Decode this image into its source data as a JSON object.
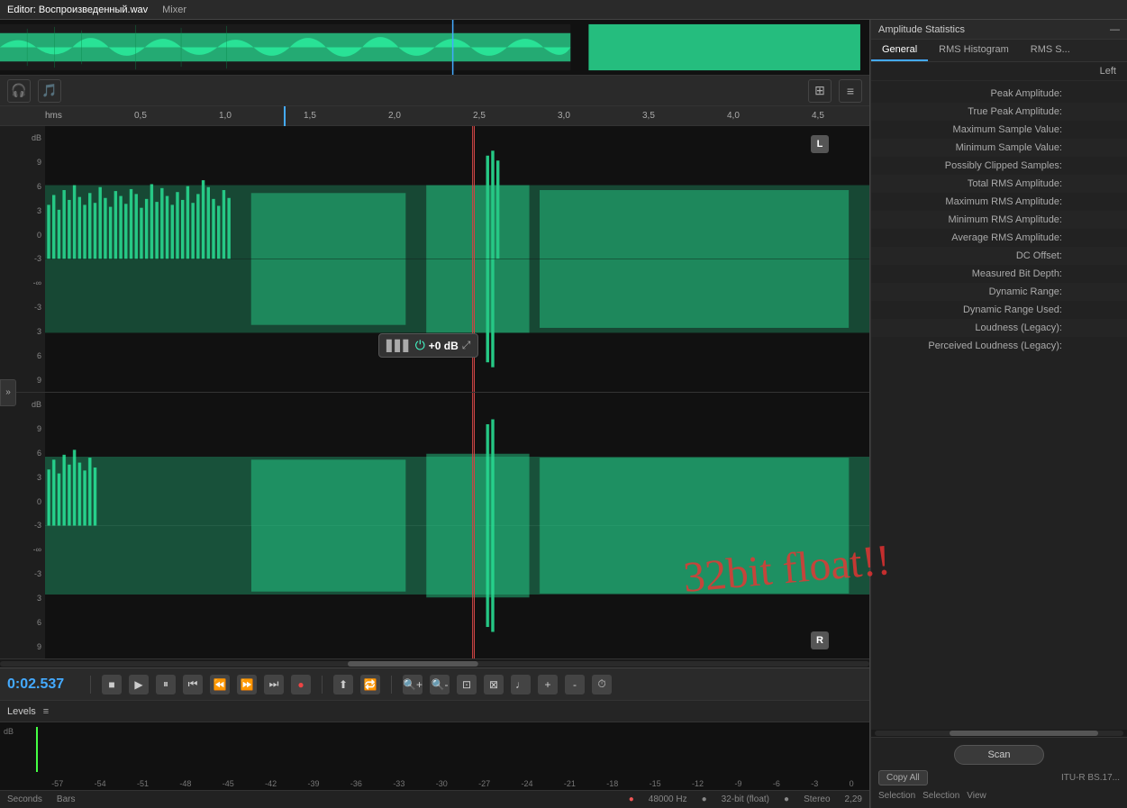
{
  "header": {
    "editor_tab": "Editor: Воспроизведенный.wav",
    "mixer_tab": "Mixer"
  },
  "timeline": {
    "labels": [
      "hms",
      "0,5",
      "1,0",
      "1,5",
      "2,0",
      "2,5",
      "3,0",
      "3,5",
      "4,0",
      "4,5"
    ]
  },
  "transport": {
    "time": "0:02.537",
    "buttons": {
      "stop": "■",
      "play": "▶",
      "pause": "⏸",
      "begin": "⏮",
      "back": "⏪",
      "forward": "⏩",
      "end": "⏭",
      "record": "●"
    }
  },
  "volume_popup": {
    "value": "+0 dB"
  },
  "levels": {
    "header": "Levels",
    "scale": [
      "dB",
      "-57",
      "-54",
      "-51",
      "-48",
      "-45",
      "-42",
      "-39",
      "-36",
      "-33",
      "-30",
      "-27",
      "-24",
      "-21",
      "-18",
      "-15",
      "-12",
      "-9",
      "-6",
      "-3",
      "0"
    ]
  },
  "status_bar": {
    "sample_rate": "48000 Hz",
    "bit_depth": "32-bit (float)",
    "channels": "Stereo",
    "duration": "2,29",
    "seconds": "Seconds",
    "bars": "Bars"
  },
  "stats_panel": {
    "title": "Amplitude Statistics",
    "tabs": [
      "General",
      "RMS Histogram",
      "RMS S..."
    ],
    "active_tab": "General",
    "channel_header": "Left",
    "rows": [
      {
        "label": "Peak Amplitude:",
        "value": ""
      },
      {
        "label": "True Peak Amplitude:",
        "value": ""
      },
      {
        "label": "Maximum Sample Value:",
        "value": ""
      },
      {
        "label": "Minimum Sample Value:",
        "value": ""
      },
      {
        "label": "Possibly Clipped Samples:",
        "value": ""
      },
      {
        "label": "Total RMS Amplitude:",
        "value": ""
      },
      {
        "label": "Maximum RMS Amplitude:",
        "value": ""
      },
      {
        "label": "Minimum RMS Amplitude:",
        "value": ""
      },
      {
        "label": "Average RMS Amplitude:",
        "value": ""
      },
      {
        "label": "DC Offset:",
        "value": ""
      },
      {
        "label": "Measured Bit Depth:",
        "value": ""
      },
      {
        "label": "Dynamic Range:",
        "value": ""
      },
      {
        "label": "Dynamic Range Used:",
        "value": ""
      },
      {
        "label": "Loudness (Legacy):",
        "value": ""
      },
      {
        "label": "Perceived Loudness (Legacy):",
        "value": ""
      }
    ],
    "scan_button": "Scan",
    "footer_note": "ITU-R BS.17...",
    "selection_labels": [
      "Selection",
      "Selection",
      "View"
    ],
    "copy_all_button": "Copy All"
  },
  "annotation": {
    "text": "32bit float!!"
  },
  "db_scale_top": [
    "dB",
    "9",
    "6",
    "3",
    "0",
    "-3",
    "-∞",
    "-3",
    "3",
    "6",
    "9"
  ],
  "db_scale_bottom": [
    "dB",
    "9",
    "6",
    "3",
    "0",
    "-3",
    "-∞",
    "-3",
    "3",
    "6",
    "9"
  ]
}
